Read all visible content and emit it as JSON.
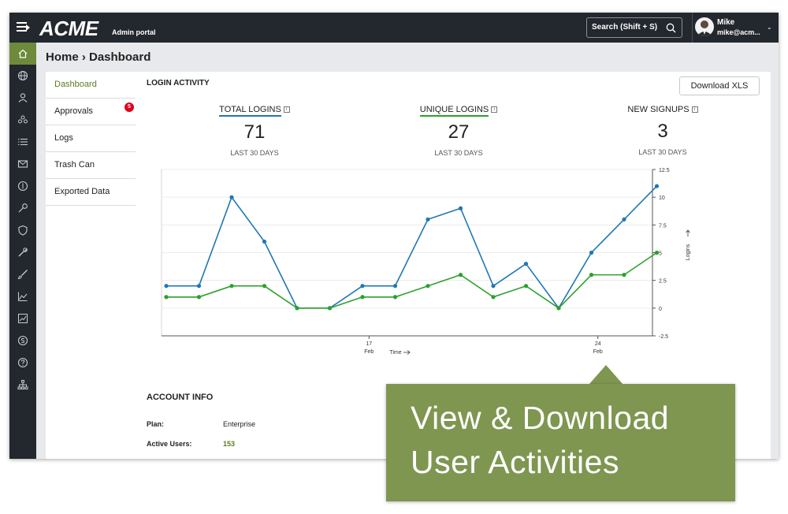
{
  "app": {
    "logo": "ACME",
    "subtitle": "Admin portal"
  },
  "search": {
    "label": "Search (Shift + S)"
  },
  "user": {
    "name": "Mike",
    "email": "mike@acm..."
  },
  "breadcrumb": "Home › Dashboard",
  "rail": {
    "icons": [
      "home-icon",
      "globe-icon",
      "user-icon",
      "users-icon",
      "list-icon",
      "mail-icon",
      "dollar-circle-icon",
      "key-icon",
      "shield-icon",
      "wrench-icon",
      "brush-icon",
      "area-chart-icon",
      "trend-chart-icon",
      "currency-icon",
      "help-icon",
      "sitemap-icon"
    ],
    "active_index": 0,
    "accent": "#6e8a3b"
  },
  "subnav": {
    "items": [
      {
        "label": "Dashboard",
        "active": true
      },
      {
        "label": "Approvals",
        "badge": "5"
      },
      {
        "label": "Logs"
      },
      {
        "label": "Trash Can"
      },
      {
        "label": "Exported Data"
      }
    ]
  },
  "login_activity": {
    "title": "LOGIN ACTIVITY",
    "download_label": "Download XLS",
    "stats": [
      {
        "label": "TOTAL LOGINS",
        "value": "71",
        "sub": "LAST 30 DAYS",
        "color": "#1f77b4"
      },
      {
        "label": "UNIQUE LOGINS",
        "value": "27",
        "sub": "LAST 30 DAYS",
        "color": "#2ca02c"
      },
      {
        "label": "NEW SIGNUPS",
        "value": "3",
        "sub": "LAST 30 DAYS"
      }
    ]
  },
  "chart_data": {
    "type": "line",
    "x": [
      1,
      2,
      3,
      4,
      5,
      6,
      7,
      8,
      9,
      10,
      11,
      12,
      13,
      14,
      15,
      16
    ],
    "series": [
      {
        "values": [
          2,
          2,
          10,
          6,
          0,
          0,
          2,
          2,
          8,
          9,
          2,
          4,
          0,
          5,
          8,
          11
        ],
        "color": "#1f77b4"
      },
      {
        "values": [
          1,
          1,
          2,
          2,
          0,
          0,
          1,
          1,
          2,
          3,
          1,
          2,
          0,
          3,
          3,
          5
        ],
        "color": "#2ca02c"
      }
    ],
    "xticks": [
      {
        "day": "17",
        "month": "Feb"
      },
      {
        "day": "24",
        "month": "Feb"
      }
    ],
    "xlabel": "Time",
    "ylabel": "Logins",
    "yticks": [
      "12.5",
      "10",
      "7.5",
      "5",
      "2.5",
      "0",
      "-2.5"
    ],
    "ylim": [
      -2.5,
      12.5
    ],
    "grid": true
  },
  "account": {
    "title": "ACCOUNT INFO",
    "plan_label": "Plan:",
    "plan_value": "Enterprise",
    "users_label": "Active Users:",
    "users_value": "153"
  },
  "callout": {
    "line1": "View & Download",
    "line2": "User Activities",
    "color": "#7f9651"
  }
}
